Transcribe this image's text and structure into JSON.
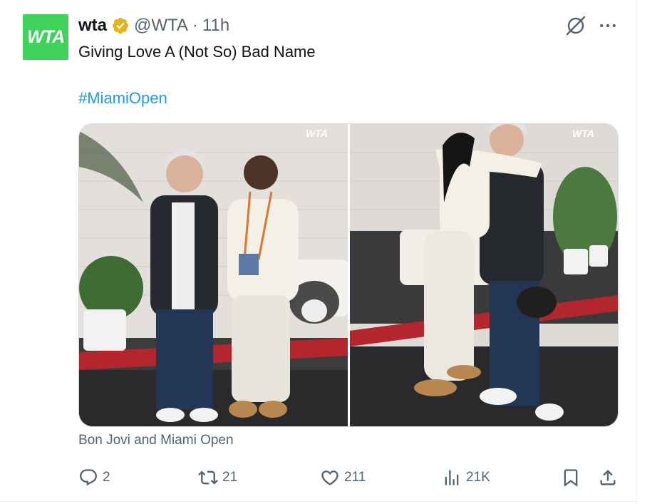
{
  "author": {
    "avatar_text": "WTA",
    "name": "wta",
    "handle": "@WTA",
    "separator": "·",
    "time": "11h"
  },
  "icons": {
    "verified": "verified-badge-icon",
    "grok": "grok-icon",
    "more": "more-icon",
    "reply": "reply-icon",
    "retweet": "retweet-icon",
    "like": "like-icon",
    "views": "views-icon",
    "bookmark": "bookmark-icon",
    "share": "share-icon"
  },
  "tweet": {
    "text": "Giving Love A (Not So) Bad Name",
    "hashtag": "#MiamiOpen"
  },
  "media": {
    "watermark_left": "WTA",
    "watermark_right": "WTA",
    "caption": "Bon Jovi and Miami Open"
  },
  "stats": {
    "replies": "2",
    "retweets": "21",
    "likes": "211",
    "views": "21K"
  },
  "colors": {
    "brand_green": "#3fd35b",
    "verified_gold": "#e2b719",
    "link_blue": "#1d9bf0",
    "secondary_text": "#536471"
  }
}
